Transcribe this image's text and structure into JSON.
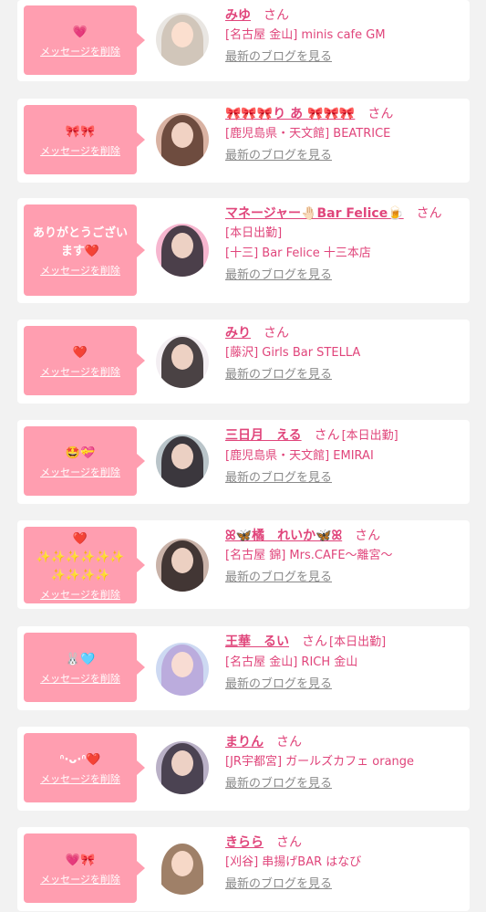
{
  "accent": "#ff9eb0",
  "name_color": "#e0457b",
  "delete_label": "メッセージを削除",
  "san": "さん",
  "blog_label": "最新のブログを見る",
  "cards": [
    {
      "message": "💗",
      "name": "みゆ",
      "shift": "",
      "lines": [
        "[名古屋 金山] minis cafe GM"
      ],
      "avatar_colors": [
        "#e9e6e2",
        "#cdbfb3"
      ]
    },
    {
      "message": "🎀🎀",
      "name": "🎀🎀🎀り あ 🎀🎀🎀",
      "shift": "",
      "lines": [
        "[鹿児島県・天文館] BEATRICE"
      ],
      "avatar_colors": [
        "#d9b2a2",
        "#5b3a2e"
      ]
    },
    {
      "message": "ありがとうございます❤️",
      "name": "マネージャー🤚🏻Bar Felice🍺",
      "shift": "",
      "lines": [
        "[本日出勤]",
        "[十三] Bar Felice 十三本店"
      ],
      "avatar_colors": [
        "#f6b6cf",
        "#2d2a33"
      ]
    },
    {
      "message": "❤️",
      "name": "みり",
      "shift": "",
      "lines": [
        "[藤沢] Girls Bar STELLA"
      ],
      "avatar_colors": [
        "#f3eef2",
        "#2b2326"
      ]
    },
    {
      "message": "🤩💝",
      "name": "三日月　える",
      "shift": "[本日出勤]",
      "lines": [
        "[鹿児島県・天文館] EMIRAI"
      ],
      "avatar_colors": [
        "#b9c4c9",
        "#241f25"
      ]
    },
    {
      "message": "❤️\n✨✨✨✨✨✨\n✨✨✨✨",
      "name": "ꕤ🦋橘　れいか🦋ꕤ",
      "shift": "",
      "lines": [
        "[名古屋 錦] Mrs.CAFE〜離宮〜"
      ],
      "avatar_colors": [
        "#c9b2a8",
        "#2a2020"
      ]
    },
    {
      "message": "🐰🩵",
      "name": "王華　るい",
      "shift": "[本日出勤]",
      "lines": [
        "[名古屋 金山] RICH 金山"
      ],
      "avatar_colors": [
        "#cdd9f2",
        "#b7a3d9"
      ]
    },
    {
      "message": "ᐢ·ᴗ·ᐢ❤️",
      "name": "まりん",
      "shift": "",
      "lines": [
        "[JR宇都宮] ガールズカフェ orange"
      ],
      "avatar_colors": [
        "#b9b0c6",
        "#37303d"
      ]
    },
    {
      "message": "💗🎀",
      "name": "きらら",
      "shift": "",
      "lines": [
        "[刈谷] 串揚げBAR はなび"
      ],
      "avatar_colors": [
        "#ffffff",
        "#8e6a4e"
      ]
    }
  ]
}
